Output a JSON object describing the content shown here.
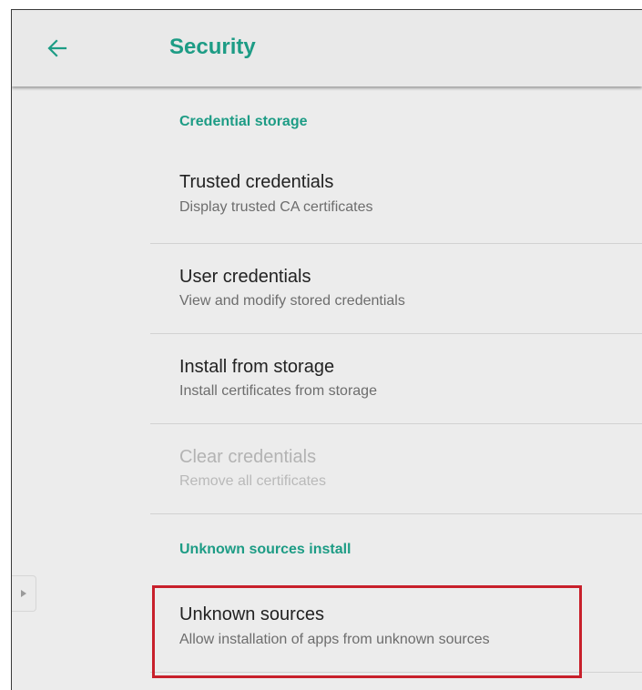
{
  "appbar": {
    "back_icon": "arrow-left-icon",
    "title": "Security"
  },
  "colors": {
    "accent": "#1d9c85",
    "background": "#ececec",
    "highlight": "#c8202b"
  },
  "sections": {
    "credential_storage": {
      "header": "Credential storage",
      "items": [
        {
          "title": "Trusted credentials",
          "subtitle": "Display trusted CA certificates",
          "enabled": true
        },
        {
          "title": "User credentials",
          "subtitle": "View and modify stored credentials",
          "enabled": true
        },
        {
          "title": "Install from storage",
          "subtitle": "Install certificates from storage",
          "enabled": true
        },
        {
          "title": "Clear credentials",
          "subtitle": "Remove all certificates",
          "enabled": false
        }
      ]
    },
    "unknown_sources": {
      "header": "Unknown sources install",
      "items": [
        {
          "title": "Unknown sources",
          "subtitle": "Allow installation of apps from unknown sources",
          "enabled": true,
          "highlighted": true
        }
      ]
    }
  },
  "drawer_handle_icon": "triangle-right-icon"
}
